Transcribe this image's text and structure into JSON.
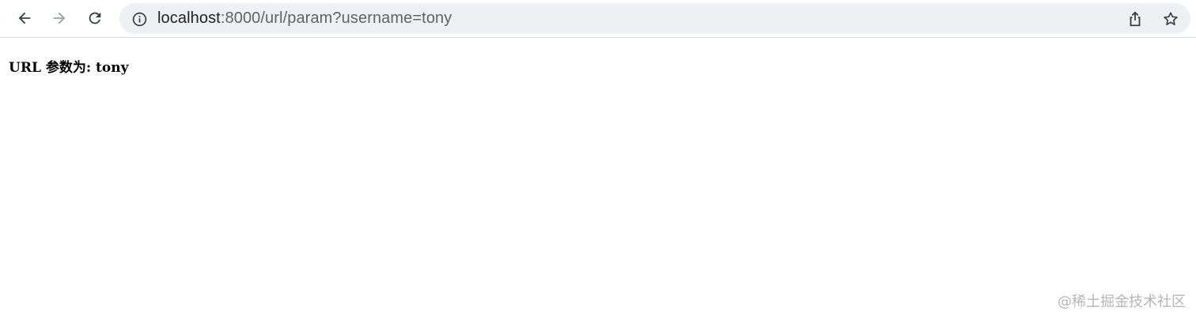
{
  "browser": {
    "address_bar": {
      "url_host": "localhost",
      "url_path": ":8000/url/param?username=tony"
    },
    "icons": {
      "back": "arrow-left-icon",
      "forward": "arrow-right-icon",
      "reload": "reload-icon",
      "site_info": "info-icon",
      "share": "share-icon",
      "bookmark": "star-icon"
    }
  },
  "page": {
    "body_text": "URL 参数为: tony"
  },
  "watermark": {
    "text": "@稀土掘金技术社区"
  }
}
